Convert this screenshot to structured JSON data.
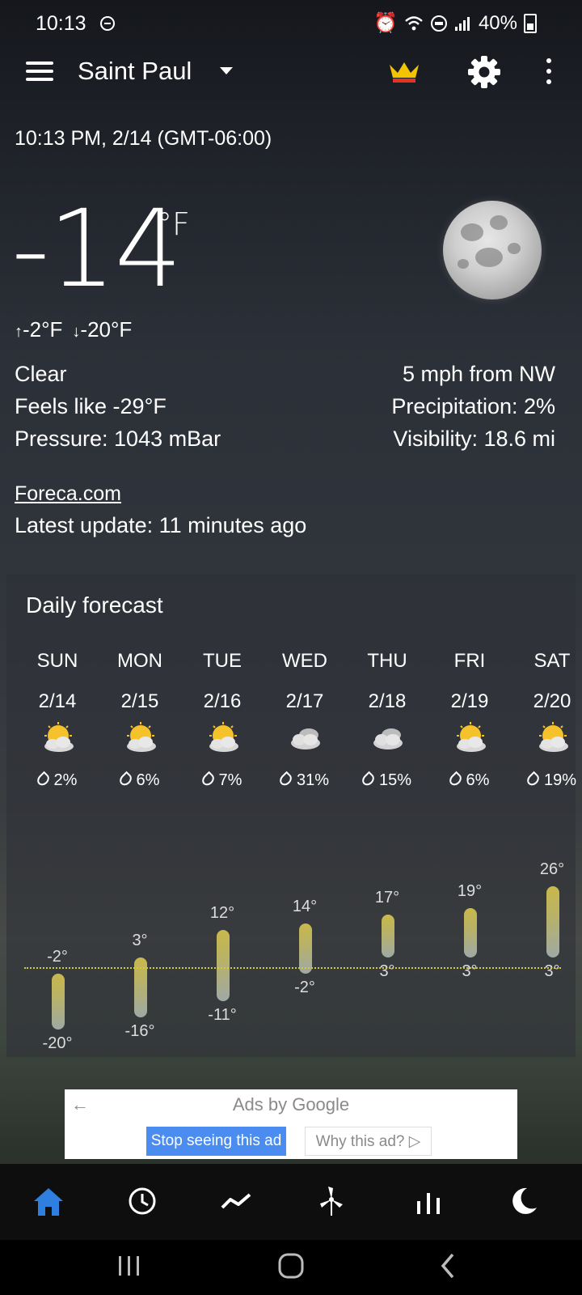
{
  "status_bar": {
    "time": "10:13",
    "battery": "40%"
  },
  "header": {
    "city": "Saint Paul"
  },
  "datetime": "10:13 PM, 2/14 (GMT-06:00)",
  "current": {
    "temperature": "-14",
    "unit": "°F",
    "high": "-2°F",
    "low": "-20°F",
    "condition": "Clear",
    "feels_like": "Feels like -29°F",
    "pressure": "Pressure: 1043 mBar",
    "wind": "5 mph from NW",
    "precipitation": "Precipitation: 2%",
    "visibility": "Visibility: 18.6 mi"
  },
  "source": {
    "link": "Foreca.com",
    "latest_update": "Latest update: 11 minutes ago"
  },
  "daily": {
    "title": "Daily forecast",
    "days": [
      {
        "day": "SUN",
        "date": "2/14",
        "precip": "2%",
        "high": "-2°",
        "low": "-20°",
        "icon": "partly-sunny-icon",
        "hi_val": -2,
        "lo_val": -20
      },
      {
        "day": "MON",
        "date": "2/15",
        "precip": "6%",
        "high": "3°",
        "low": "-16°",
        "icon": "partly-sunny-icon",
        "hi_val": 3,
        "lo_val": -16
      },
      {
        "day": "TUE",
        "date": "2/16",
        "precip": "7%",
        "high": "12°",
        "low": "-11°",
        "icon": "partly-sunny-icon",
        "hi_val": 12,
        "lo_val": -11
      },
      {
        "day": "WED",
        "date": "2/17",
        "precip": "31%",
        "high": "14°",
        "low": "-2°",
        "icon": "cloudy-icon",
        "hi_val": 14,
        "lo_val": -2
      },
      {
        "day": "THU",
        "date": "2/18",
        "precip": "15%",
        "high": "17°",
        "low": "3°",
        "icon": "cloudy-icon",
        "hi_val": 17,
        "lo_val": 3
      },
      {
        "day": "FRI",
        "date": "2/19",
        "precip": "6%",
        "high": "19°",
        "low": "3°",
        "icon": "partly-sunny-icon",
        "hi_val": 19,
        "lo_val": 3
      },
      {
        "day": "SAT",
        "date": "2/20",
        "precip": "19%",
        "high": "26°",
        "low": "3°",
        "icon": "partly-sunny-icon",
        "hi_val": 26,
        "lo_val": 3
      }
    ]
  },
  "ad": {
    "title": "Ads by Google",
    "stop_label": "Stop seeing this ad",
    "why_label": "Why this ad? ▷"
  },
  "colors": {
    "bar_top": "#c9b84b",
    "bar_bottom": "#9fa9a5",
    "ad_button": "#4a8cf0",
    "nav_active": "#2f7fe0",
    "zero_line": "#d6c840"
  }
}
